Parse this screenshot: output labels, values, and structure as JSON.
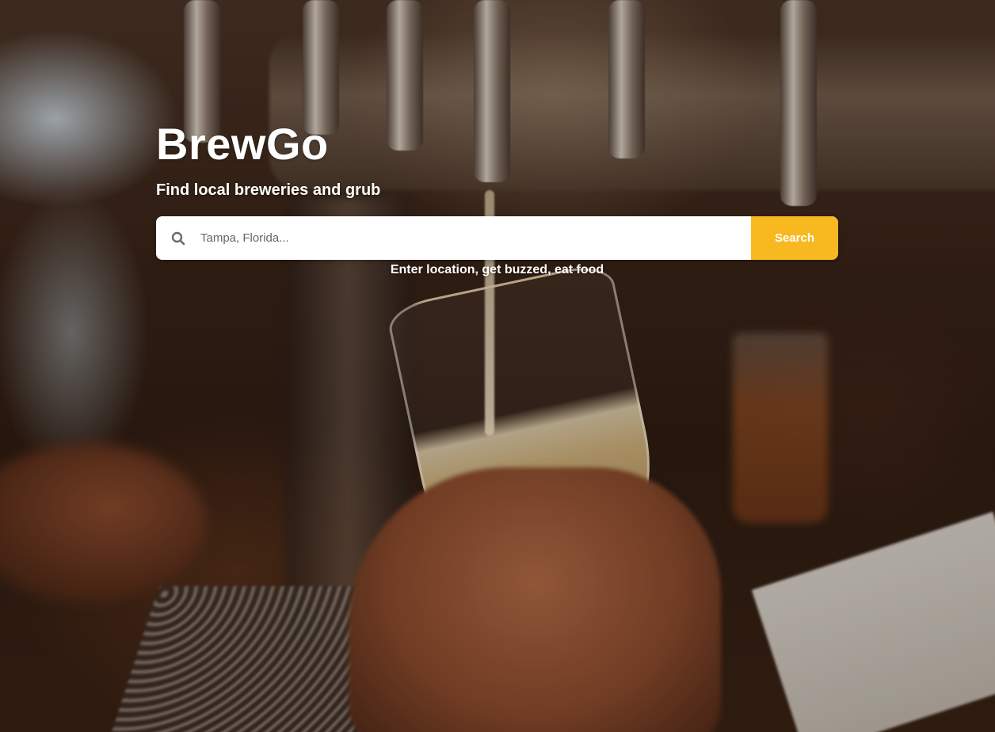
{
  "hero": {
    "title": "BrewGo",
    "tagline": "Find local breweries and grub",
    "helper_text": "Enter location, get buzzed, eat food"
  },
  "search": {
    "placeholder": "Tampa, Florida...",
    "value": "",
    "button_label": "Search",
    "icon": "search-icon"
  },
  "colors": {
    "accent": "#f8b820",
    "text": "#ffffff",
    "input_bg": "#ffffff"
  }
}
